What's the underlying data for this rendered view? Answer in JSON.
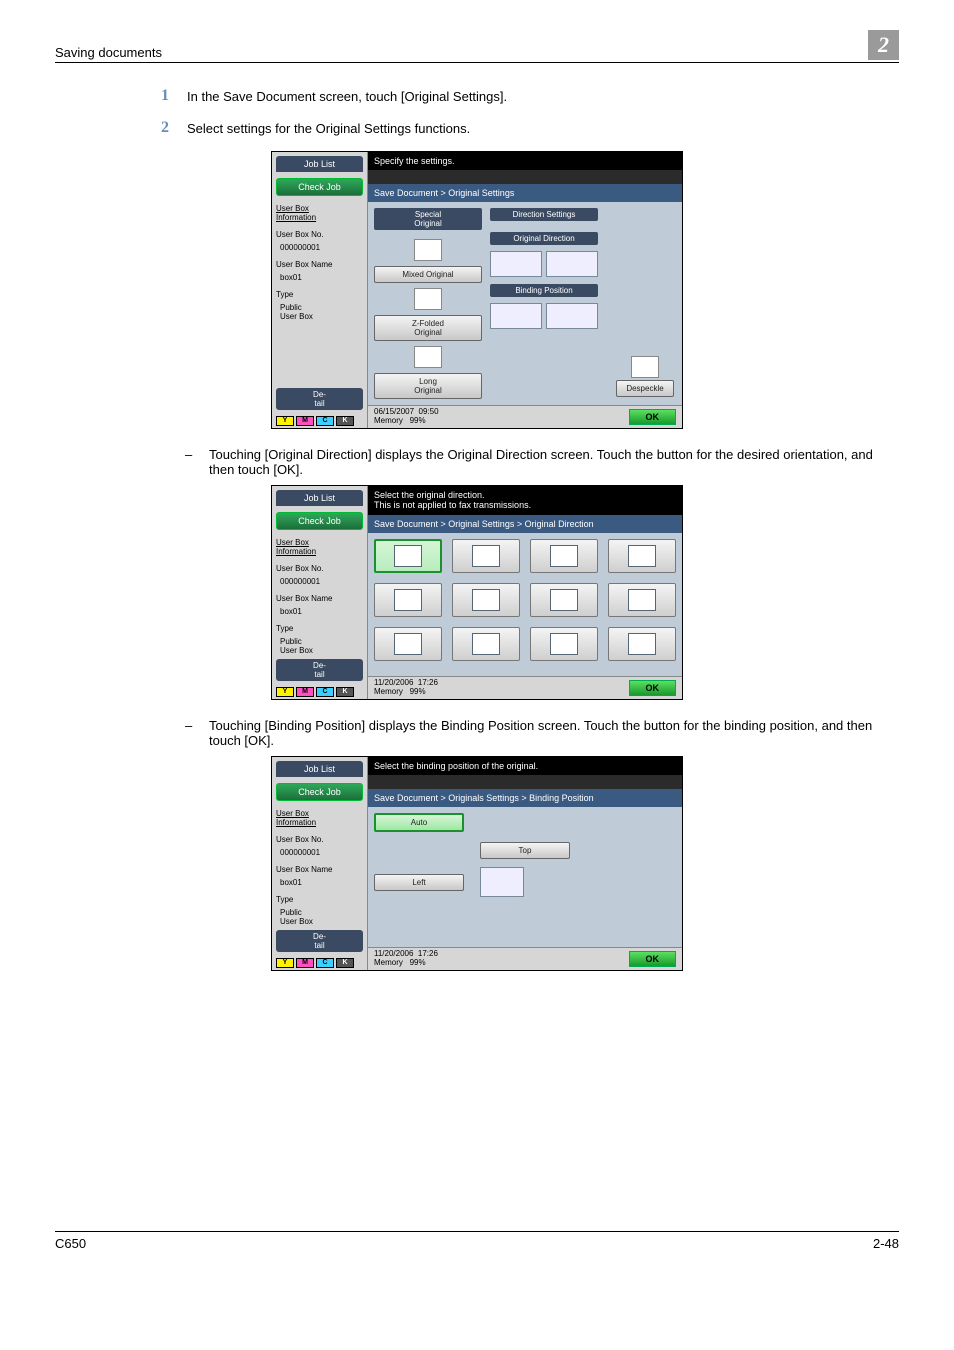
{
  "header": {
    "title": "Saving documents",
    "chapter": "2"
  },
  "steps": [
    {
      "num": "1",
      "text": "In the Save Document screen, touch [Original Settings]."
    },
    {
      "num": "2",
      "text": "Select settings for the Original Settings functions."
    }
  ],
  "subs": [
    {
      "dash": "–",
      "text": "Touching [Original Direction] displays the Original Direction screen. Touch the button for the desired orientation, and then touch [OK]."
    },
    {
      "dash": "–",
      "text": "Touching [Binding Position] displays the Binding Position screen. Touch the button for the binding position, and then touch [OK]."
    }
  ],
  "sidebar": {
    "job_list": "Job List",
    "check_job": "Check Job",
    "user_box_info": "User Box\nInformation",
    "user_box_no_lbl": "User Box No.",
    "user_box_no_val": "000000001",
    "user_box_name_lbl": "User Box Name",
    "user_box_name_val": "box01",
    "type_lbl": "Type",
    "type_val": "Public\nUser Box",
    "detail": "De-\ntail",
    "toners": {
      "y": "Y",
      "m": "M",
      "c": "C",
      "k": "K"
    }
  },
  "screen1": {
    "msg": "Specify the settings.",
    "crumb": "Save Document > Original Settings",
    "special": "Special\nOriginal",
    "mixed": "Mixed Original",
    "zfold": "Z-Folded\nOriginal",
    "long": "Long\nOriginal",
    "dir_settings": "Direction Settings",
    "orig_dir": "Original Direction",
    "bind_pos": "Binding Position",
    "despeckle": "Despeckle",
    "date": "06/15/2007",
    "time": "09:50",
    "mem_lbl": "Memory",
    "mem_val": "99%",
    "ok": "OK"
  },
  "screen2": {
    "msg": "Select the original direction.\nThis is not applied to fax transmissions.",
    "crumb": "Save Document > Original Settings > Original Direction",
    "date": "11/20/2006",
    "time": "17:26",
    "mem_lbl": "Memory",
    "mem_val": "99%",
    "ok": "OK"
  },
  "screen3": {
    "msg": "Select the binding position of the original.",
    "crumb": "Save Document > Originals Settings > Binding Position",
    "auto": "Auto",
    "top": "Top",
    "left": "Left",
    "date": "11/20/2006",
    "time": "17:26",
    "mem_lbl": "Memory",
    "mem_val": "99%",
    "ok": "OK"
  },
  "footer": {
    "left": "C650",
    "right": "2-48"
  }
}
